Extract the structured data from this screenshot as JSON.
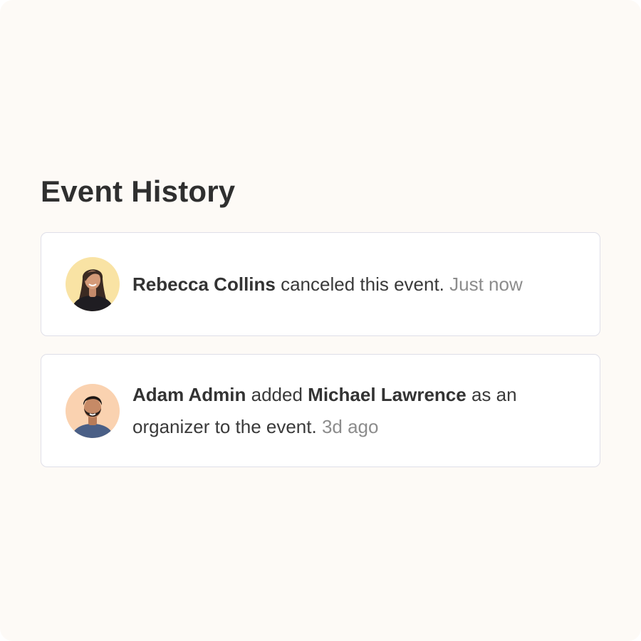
{
  "page": {
    "title": "Event History"
  },
  "events": [
    {
      "actor": "Rebecca Collins",
      "action": "canceled this event.",
      "time": "Just now",
      "avatar_icon": "avatar-woman-icon",
      "avatar_bg": "#f9e3a4"
    },
    {
      "actor": "Adam Admin",
      "action_1": "added",
      "target": "Michael Lawrence",
      "action_2": "as an organizer to the event.",
      "time": "3d ago",
      "avatar_icon": "avatar-man-icon",
      "avatar_bg": "#fad2b0"
    }
  ],
  "colors": {
    "background": "#fdfaf6",
    "card_border": "#dfdfe8",
    "text": "#333333",
    "muted": "#8c8c8c"
  }
}
